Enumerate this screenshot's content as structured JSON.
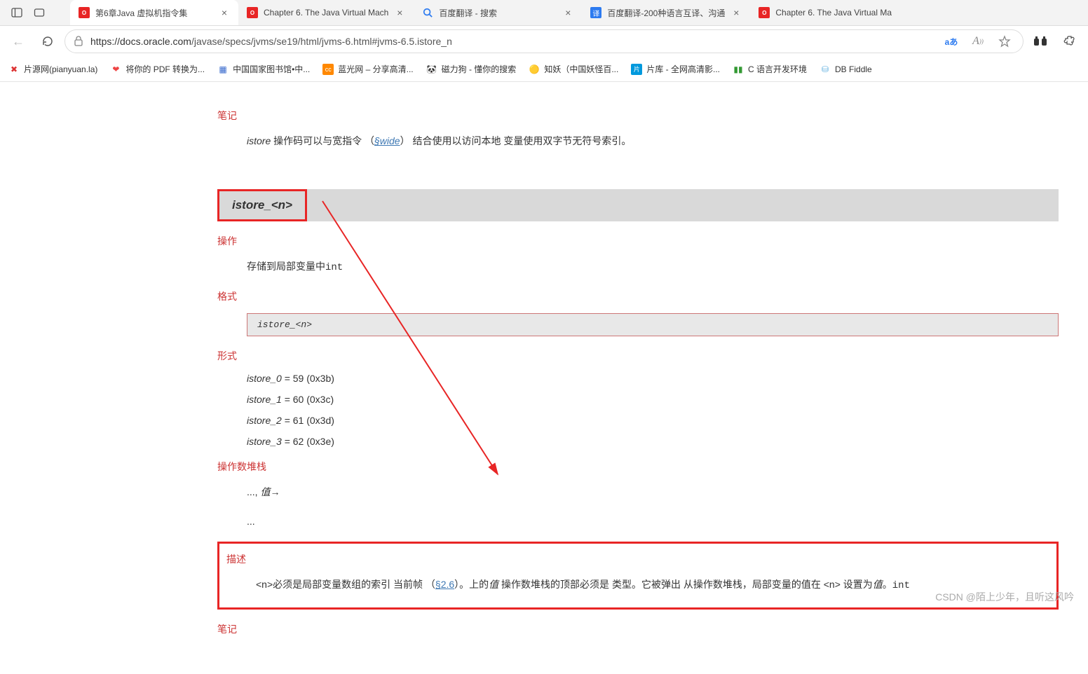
{
  "window_controls": {
    "sidebar": "▣",
    "tabs": "▢"
  },
  "tabs": [
    {
      "favicon": "oracle",
      "title": "第6章Java 虚拟机指令集",
      "active": true
    },
    {
      "favicon": "oracle",
      "title": "Chapter 6. The Java Virtual Mach"
    },
    {
      "favicon": "baidu",
      "title": "百度翻译 - 搜索"
    },
    {
      "favicon": "trans",
      "title": "百度翻译-200种语言互译、沟通"
    },
    {
      "favicon": "oracle",
      "title": "Chapter 6. The Java Virtual Ma"
    }
  ],
  "url": {
    "proto_host": "https://docs.oracle.com",
    "path": "/javase/specs/jvms/se19/html/jvms-6.html#jvms-6.5.istore_n"
  },
  "addr_icons": {
    "aa": "aあ"
  },
  "bookmarks": [
    {
      "icon": "pianyuan",
      "label": "片源网(pianyuan.la)"
    },
    {
      "icon": "pdf",
      "label": "将你的 PDF 转换为..."
    },
    {
      "icon": "nlc",
      "label": "中国国家图书馆•中..."
    },
    {
      "icon": "languang",
      "label": "蓝光网 – 分享高清..."
    },
    {
      "icon": "panda",
      "label": "磁力狗 - 懂你的搜索"
    },
    {
      "icon": "zhiyao",
      "label": "知妖（中国妖怪百..."
    },
    {
      "icon": "pianku",
      "label": "片库 - 全网高清影..."
    },
    {
      "icon": "clang",
      "label": "C 语言开发环境"
    },
    {
      "icon": "dbfiddle",
      "label": "DB Fiddle"
    }
  ],
  "sections": {
    "notes_label": "笔记",
    "notes_text_pre": "istore 操作码可以与宽指令 （",
    "notes_link": "§wide",
    "notes_text_post": "） 结合使用以访问本地 变量使用双字节无符号索引。",
    "header": "istore_<n>",
    "op_label": "操作",
    "op_text_pre": "存储到局部变量中",
    "op_text_code": "int",
    "format_label": "格式",
    "format_text": "istore_<n>",
    "forms_label": "形式",
    "forms": [
      {
        "name": "istore_0",
        "eq": " = 59   (0x3b)"
      },
      {
        "name": "istore_1",
        "eq": " = 60   (0x3c)"
      },
      {
        "name": "istore_2",
        "eq": " = 61   (0x3d)"
      },
      {
        "name": "istore_3",
        "eq": " = 62   (0x3e)"
      }
    ],
    "stack_label": "操作数堆栈",
    "stack_line1_pre": "..., ",
    "stack_line1_val": "值",
    "stack_line1_post": "→",
    "stack_line2": "...",
    "desc_label": "描述",
    "desc_pre": "<n>必须是局部变量数组的索引 当前帧 （",
    "desc_link": "§2.6",
    "desc_mid": "）。上的",
    "desc_val1": "值",
    "desc_mid2": " 操作数堆栈的顶部必须是 类型。它被弹出 从操作数堆栈，局部变量的值在 <n> 设置为",
    "desc_val2": "值",
    "desc_post": "。",
    "desc_code": "int",
    "notes2_label": "笔记"
  },
  "watermark": "CSDN @陌上少年，且听这风吟"
}
